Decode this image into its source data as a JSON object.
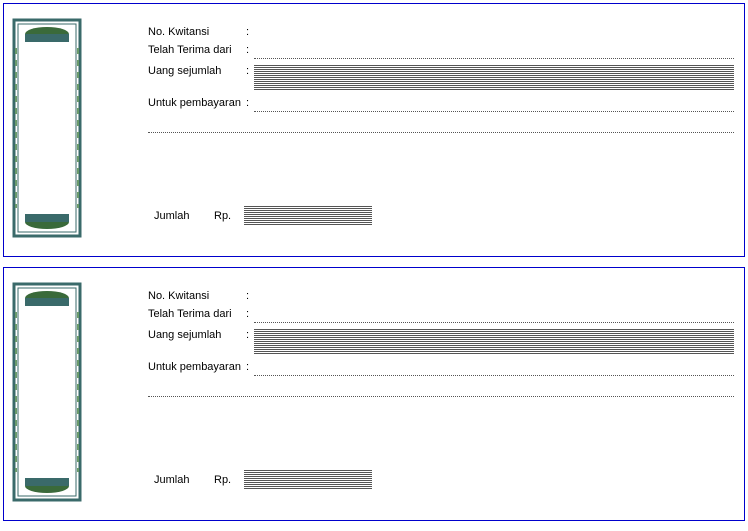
{
  "receipt": {
    "labels": {
      "no_kwitansi": "No. Kwitansi",
      "telah_terima_dari": "Telah Terima dari",
      "uang_sejumlah": "Uang sejumlah",
      "untuk_pembayaran": "Untuk pembayaran",
      "jumlah": "Jumlah",
      "rp": "Rp."
    },
    "values": {
      "no_kwitansi": "",
      "telah_terima_dari": "",
      "uang_sejumlah": "",
      "untuk_pembayaran": "",
      "jumlah": ""
    }
  }
}
